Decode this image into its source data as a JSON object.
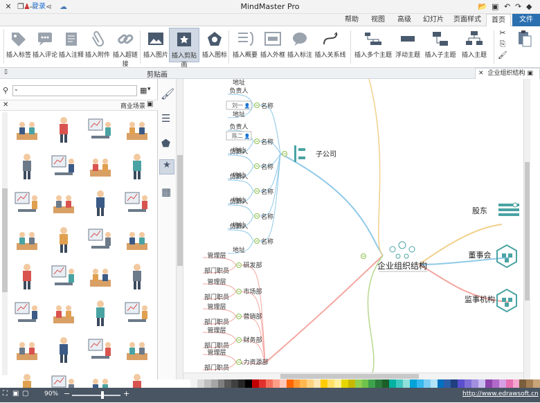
{
  "window": {
    "title": "MindMaster Pro",
    "login": "登录"
  },
  "menu_tabs": [
    {
      "label": "文件"
    },
    {
      "label": "首页"
    },
    {
      "label": "页面样式"
    },
    {
      "label": "幻灯片"
    },
    {
      "label": "高级"
    },
    {
      "label": "视图"
    },
    {
      "label": "帮助"
    }
  ],
  "ribbon_buttons": [
    {
      "label": "插入主题"
    },
    {
      "label": "插入子主题"
    },
    {
      "label": "浮动主题"
    },
    {
      "label": "插入多个主题"
    },
    {
      "label": "插入关系线"
    },
    {
      "label": "插入标注"
    },
    {
      "label": "插入外框"
    },
    {
      "label": "插入概要"
    },
    {
      "label": "插入图标"
    },
    {
      "label": "插入剪贴画"
    },
    {
      "label": "插入图片"
    },
    {
      "label": "插入超链接"
    },
    {
      "label": "插入附件"
    },
    {
      "label": "插入注释"
    },
    {
      "label": "插入评论"
    },
    {
      "label": "插入标签"
    }
  ],
  "doc_tab": {
    "label": "企业组织结构"
  },
  "panel": {
    "title": "剪贴画",
    "category": "商业场景",
    "search_placeholder": ""
  },
  "mindmap": {
    "central": "企业组织结构",
    "right_topics": [
      "股东",
      "董事会",
      "监事机构"
    ],
    "branch_a": "子公司",
    "items_a": [
      "地址",
      "负责人",
      "名称",
      "地址",
      "负责人",
      "名称",
      "地址",
      "负责人",
      "名称",
      "地址",
      "负责人",
      "名称",
      "地址",
      "负责人",
      "名称",
      "地址",
      "负责人",
      "名称",
      "地址"
    ],
    "depts": [
      "研发部",
      "市场部",
      "营销部",
      "财务部",
      "人力资源部"
    ],
    "dept_leaves": [
      "管理层",
      "部门职员"
    ],
    "persons": [
      "刘一",
      "陈二"
    ]
  },
  "status": {
    "url": "http://www.edrawsoft.cn",
    "zoom": "90%"
  },
  "palette": [
    "#ffffff",
    "#f2f2f2",
    "#d9d9d9",
    "#bfbfbf",
    "#a6a6a6",
    "#7f7f7f",
    "#595959",
    "#404040",
    "#262626",
    "#000000",
    "#c00000",
    "#e0312e",
    "#f5705b",
    "#ff9f87",
    "#ffc7b8",
    "#ff6600",
    "#ff9933",
    "#ffb84d",
    "#ffd27f",
    "#ffe6b3",
    "#ffcc00",
    "#ffe066",
    "#fff099",
    "#e6d600",
    "#c8b900",
    "#92d050",
    "#6fc24a",
    "#3fa34d",
    "#2b7a3b",
    "#1c5e2a",
    "#00b0a0",
    "#3ec7c0",
    "#8fe0da",
    "#00a3d9",
    "#36b7ee",
    "#7ccdf3",
    "#b3e3f9",
    "#0070c0",
    "#2d5fa8",
    "#1f3f80",
    "#5b4fcf",
    "#7f6fd6",
    "#a28fe0",
    "#c9bdf0",
    "#8e44ad",
    "#b06ac9",
    "#d59fe4",
    "#e86fb1",
    "#f4a6cf",
    "#7b5e3b",
    "#a47d52",
    "#c9a47a"
  ]
}
